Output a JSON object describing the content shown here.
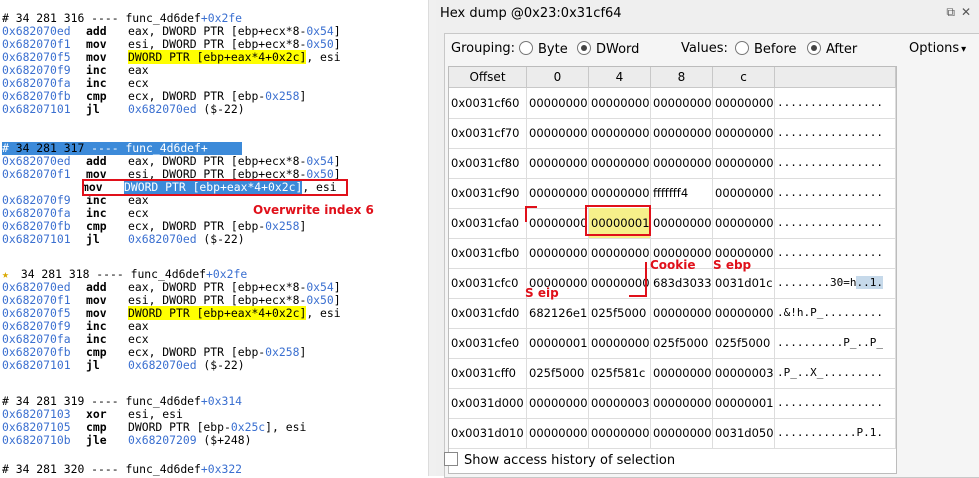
{
  "disasm": {
    "blocks": [
      {
        "header": {
          "hash": "#",
          "ln": "34 281 316",
          "dashes": "----",
          "func": "func_4d6def",
          "off": "+0x2fe"
        },
        "lines": [
          {
            "addr": "0x682070ed",
            "mn": "add",
            "op": "eax, DWORD PTR [ebp+ecx*8-",
            "num": "0x54",
            "tail": "]"
          },
          {
            "addr": "0x682070f1",
            "mn": "mov",
            "op": "esi, DWORD PTR [ebp+ecx*8-",
            "num": "0x50",
            "tail": "]"
          },
          {
            "addr": "0x682070f5",
            "mn": "mov",
            "hl": "DWORD PTR [ebp+eax*4+0x2c]",
            "op2": ", esi"
          },
          {
            "addr": "0x682070f9",
            "mn": "inc",
            "op": "eax"
          },
          {
            "addr": "0x682070fa",
            "mn": "inc",
            "op": "ecx"
          },
          {
            "addr": "0x682070fb",
            "mn": "cmp",
            "op": "ecx, DWORD PTR [ebp-",
            "num": "0x258",
            "tail": "]"
          },
          {
            "addr": "0x68207101",
            "mn": "jl",
            "jmp": "0x682070ed",
            "op": " ($-22)"
          }
        ]
      },
      {
        "header": {
          "hash": "#",
          "ln": "34 281 317",
          "dashes": "----",
          "func": "func_4d6def+",
          "off": ""
        },
        "lines": [
          {
            "addr": "0x682070ed",
            "mn": "add",
            "op": "eax, DWORD PTR [ebp+ecx*8-",
            "num": "0x54",
            "tail": "]"
          },
          {
            "addr": "0x682070f1",
            "mn": "mov",
            "op": "esi, DWORD PTR [ebp+ecx*8-",
            "num": "0x50",
            "tail": "]"
          },
          {
            "addr": "",
            "mn": "mov",
            "hl": "DWORD PTR [ebp+eax*4+0x2c]",
            "op2": ", esi"
          },
          {
            "addr": "0x682070f9",
            "mn": "inc",
            "op": "eax"
          },
          {
            "addr": "0x682070fa",
            "mn": "inc",
            "op": "ecx"
          },
          {
            "addr": "0x682070fb",
            "mn": "cmp",
            "op": "ecx, DWORD PTR [ebp-",
            "num": "0x258",
            "tail": "]"
          },
          {
            "addr": "0x68207101",
            "mn": "jl",
            "jmp": "0x682070ed",
            "op": " ($-22)"
          }
        ]
      },
      {
        "header": {
          "hash": "",
          "ln": "34 281 318",
          "dashes": "----",
          "func": "func_4d6def",
          "off": "+0x2fe"
        },
        "lines": [
          {
            "addr": "0x682070ed",
            "mn": "add",
            "op": "eax, DWORD PTR [ebp+ecx*8-",
            "num": "0x54",
            "tail": "]"
          },
          {
            "addr": "0x682070f1",
            "mn": "mov",
            "op": "esi, DWORD PTR [ebp+ecx*8-",
            "num": "0x50",
            "tail": "]"
          },
          {
            "addr": "0x682070f5",
            "mn": "mov",
            "hl": "DWORD PTR [ebp+eax*4+0x2c]",
            "op2": ", esi"
          },
          {
            "addr": "0x682070f9",
            "mn": "inc",
            "op": "eax"
          },
          {
            "addr": "0x682070fa",
            "mn": "inc",
            "op": "ecx"
          },
          {
            "addr": "0x682070fb",
            "mn": "cmp",
            "op": "ecx, DWORD PTR [ebp-",
            "num": "0x258",
            "tail": "]"
          },
          {
            "addr": "0x68207101",
            "mn": "jl",
            "jmp": "0x682070ed",
            "op": " ($-22)"
          }
        ]
      },
      {
        "header": {
          "hash": "#",
          "ln": "34 281 319",
          "dashes": "----",
          "func": "func_4d6def",
          "off": "+0x314"
        },
        "lines": [
          {
            "addr": "0x68207103",
            "mn": "xor",
            "op": "esi, esi"
          },
          {
            "addr": "0x68207105",
            "mn": "cmp",
            "op": "DWORD PTR [ebp-",
            "num": "0x25c",
            "tail": "], esi"
          },
          {
            "addr": "0x6820710b",
            "mn": "jle",
            "jmp": "0x68207209",
            "op": " ($+248)"
          }
        ]
      },
      {
        "header": {
          "hash": "#",
          "ln": "34 281 320",
          "dashes": "----",
          "func": "func_4d6def",
          "off": "+0x322"
        },
        "lines": []
      }
    ],
    "annotation": "Overwrite index 6"
  },
  "hex": {
    "title": "Hex dump @0x23:0x31cf64",
    "toolbar": {
      "grouping_label": "Grouping:",
      "byte_label": "Byte",
      "dword_label": "DWord",
      "values_label": "Values:",
      "before_label": "Before",
      "after_label": "After",
      "options_label": "Options"
    },
    "columns": [
      "Offset",
      "0",
      "4",
      "8",
      "c",
      ""
    ],
    "rows": [
      {
        "off": "0x0031cf60",
        "c0": "00000000",
        "c4": "00000000",
        "c8": "00000000",
        "cc": "00000000",
        "ascii": "................"
      },
      {
        "off": "0x0031cf70",
        "c0": "00000000",
        "c4": "00000000",
        "c8": "00000000",
        "cc": "00000000",
        "ascii": "................"
      },
      {
        "off": "0x0031cf80",
        "c0": "00000000",
        "c4": "00000000",
        "c8": "00000000",
        "cc": "00000000",
        "ascii": "................"
      },
      {
        "off": "0x0031cf90",
        "c0": "00000000",
        "c4": "00000000",
        "c8": "fffffff4",
        "cc": "00000000",
        "ascii": "................"
      },
      {
        "off": "0x0031cfa0",
        "c0": "00000000",
        "c4": "00000001",
        "c8": "00000000",
        "cc": "00000000",
        "ascii": "................"
      },
      {
        "off": "0x0031cfb0",
        "c0": "00000000",
        "c4": "00000000",
        "c8": "00000000",
        "cc": "00000000",
        "ascii": "................"
      },
      {
        "off": "0x0031cfc0",
        "c0": "00000000",
        "c4": "00000000",
        "c8": "683d3033",
        "cc": "0031d01c",
        "ascii_a": "........30=h",
        "ascii_b": "..1."
      },
      {
        "off": "0x0031cfd0",
        "c0": "682126e1",
        "c4": "025f5000",
        "c8": "00000000",
        "cc": "00000000",
        "ascii": ".&!h.P_........."
      },
      {
        "off": "0x0031cfe0",
        "c0": "00000001",
        "c4": "00000000",
        "c8": "025f5000",
        "cc": "025f5000",
        "ascii": "..........P_..P_"
      },
      {
        "off": "0x0031cff0",
        "c0": "025f5000",
        "c4": "025f581c",
        "c8": "00000000",
        "cc": "00000003",
        "ascii": ".P_..X_........."
      },
      {
        "off": "0x0031d000",
        "c0": "00000000",
        "c4": "00000003",
        "c8": "00000000",
        "cc": "00000001",
        "ascii": "................"
      },
      {
        "off": "0x0031d010",
        "c0": "00000000",
        "c4": "00000000",
        "c8": "00000000",
        "cc": "0031d050",
        "ascii": "............P.1."
      }
    ],
    "annotations": {
      "cookie": "Cookie",
      "sebp": "S ebp",
      "seip": "S eip"
    },
    "bottom_label": "Show access history of selection"
  }
}
